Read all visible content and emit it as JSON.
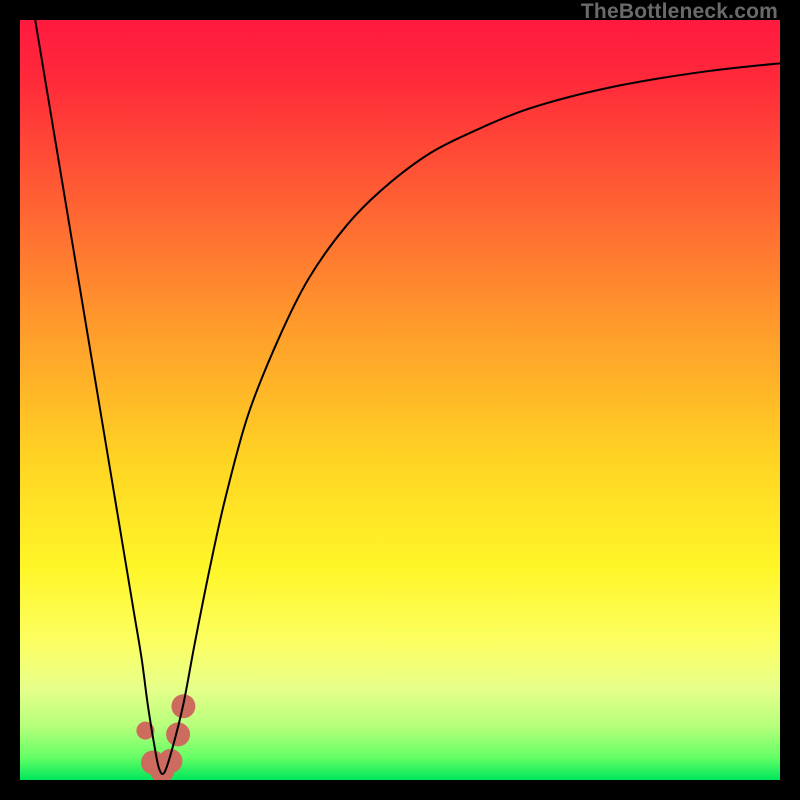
{
  "watermark": "TheBottleneck.com",
  "chart_data": {
    "type": "line",
    "title": "",
    "xlabel": "",
    "ylabel": "",
    "xlim": [
      0,
      100
    ],
    "ylim": [
      0,
      100
    ],
    "background_gradient": {
      "stops": [
        {
          "offset": 0.0,
          "color": "#ff1a3f"
        },
        {
          "offset": 0.08,
          "color": "#ff2a3a"
        },
        {
          "offset": 0.22,
          "color": "#ff5a34"
        },
        {
          "offset": 0.4,
          "color": "#ff9a2c"
        },
        {
          "offset": 0.58,
          "color": "#ffd423"
        },
        {
          "offset": 0.72,
          "color": "#fff628"
        },
        {
          "offset": 0.82,
          "color": "#fcff63"
        },
        {
          "offset": 0.88,
          "color": "#e6ff8a"
        },
        {
          "offset": 0.93,
          "color": "#b5ff7a"
        },
        {
          "offset": 0.97,
          "color": "#66ff66"
        },
        {
          "offset": 1.0,
          "color": "#00e65c"
        }
      ]
    },
    "series": [
      {
        "name": "bottleneck-curve",
        "color": "#000000",
        "width": 2,
        "x": [
          2.0,
          4.0,
          6.0,
          8.0,
          10.0,
          12.0,
          13.0,
          14.0,
          15.0,
          16.0,
          16.8,
          17.6,
          18.3,
          19.0,
          20.0,
          21.5,
          23.0,
          25.0,
          27.0,
          30.0,
          34.0,
          38.0,
          43.0,
          48.0,
          54.0,
          60.0,
          66.0,
          72.0,
          78.0,
          84.0,
          90.0,
          95.0,
          100.0
        ],
        "y": [
          100.0,
          88.0,
          76.0,
          64.0,
          52.0,
          40.0,
          34.0,
          28.0,
          22.0,
          16.0,
          10.0,
          5.0,
          1.5,
          1.0,
          4.0,
          10.0,
          18.0,
          28.0,
          37.0,
          48.0,
          58.0,
          66.0,
          73.0,
          78.0,
          82.5,
          85.5,
          88.0,
          89.8,
          91.2,
          92.3,
          93.2,
          93.8,
          94.3
        ]
      }
    ],
    "marker": {
      "name": "optimal-marker",
      "color": "#cc6b5e",
      "points": [
        {
          "x": 16.5,
          "y": 6.5,
          "r": 9
        },
        {
          "x": 17.5,
          "y": 2.3,
          "r": 12
        },
        {
          "x": 18.7,
          "y": 1.2,
          "r": 12
        },
        {
          "x": 19.8,
          "y": 2.5,
          "r": 12
        },
        {
          "x": 20.8,
          "y": 6.0,
          "r": 12
        },
        {
          "x": 21.5,
          "y": 9.7,
          "r": 12
        }
      ]
    }
  }
}
